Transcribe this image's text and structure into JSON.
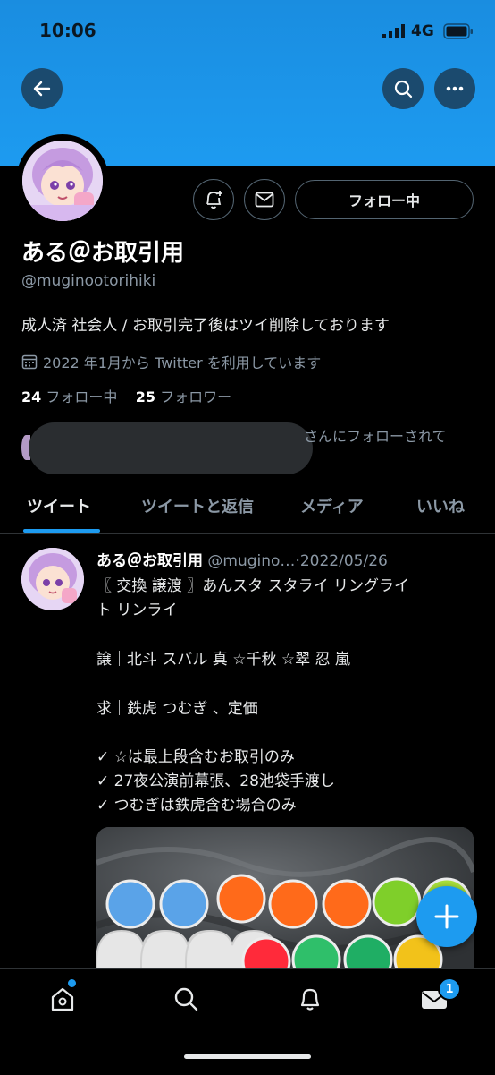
{
  "status_bar": {
    "time": "10:06",
    "network": "4G"
  },
  "profile": {
    "display_name": "ある＠お取引用",
    "handle": "@muginootorihiki",
    "bio": "成人済 社会人 / お取引完了後はツイ削除しております",
    "joined": "2022 年1月から Twitter を利用しています",
    "following_count": "24",
    "following_label": "フォロー中",
    "followers_count": "25",
    "followers_label": "フォロワー",
    "followed_by_text": "さんにフォローされて",
    "follow_button_label": "フォロー中"
  },
  "tabs": [
    {
      "label": "ツイート",
      "active": true
    },
    {
      "label": "ツイートと返信",
      "active": false
    },
    {
      "label": "メディア",
      "active": false
    },
    {
      "label": "いいね",
      "active": false
    }
  ],
  "tweet": {
    "author_name": "ある＠お取引用",
    "author_handle": "@mugino…",
    "separator": "·",
    "date": "2022/05/26",
    "lines": [
      "〖 交換 譲渡 〗あんスタ スタライ リングライ",
      "ト リンライ",
      "",
      "譲｜北斗 スバル 真 ☆千秋 ☆翠 忍 嵐",
      "",
      "求｜鉄虎 つむぎ 、定価",
      "",
      "✓ ☆は最上段含むお取引のみ",
      "✓ 27夜公演前幕張、28池袋手渡し",
      "✓ つむぎは鉄虎含む場合のみ"
    ]
  },
  "bottom_nav": {
    "messages_badge": "1"
  },
  "colors": {
    "accent": "#1d9bf0",
    "background": "#000000",
    "muted": "#8b98a5"
  }
}
